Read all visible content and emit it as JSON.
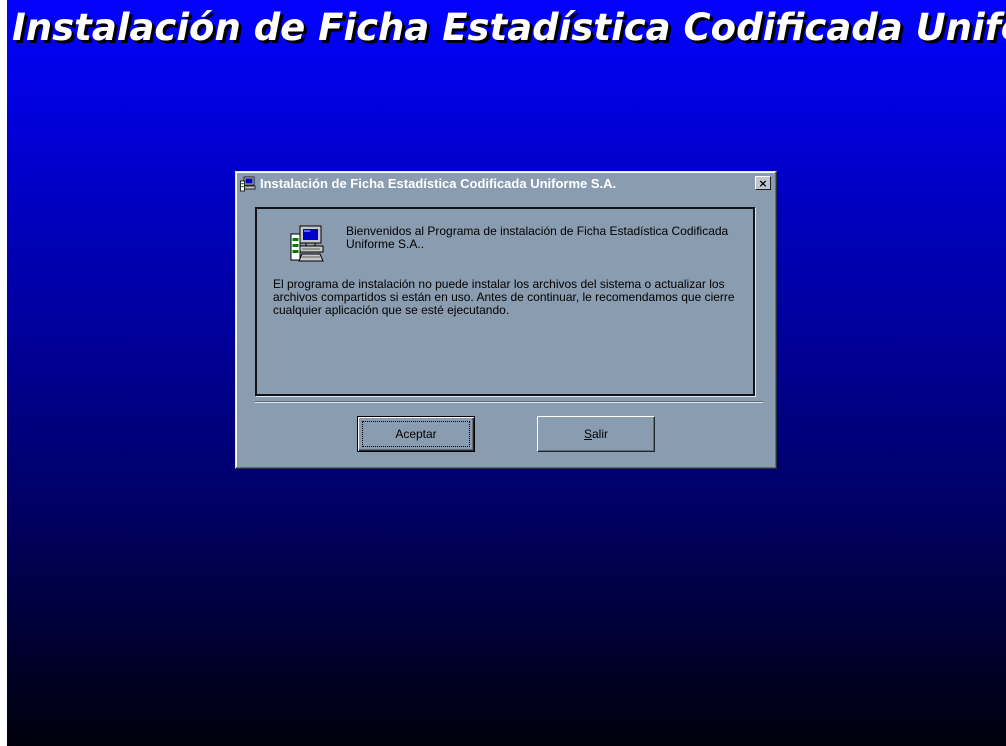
{
  "banner": {
    "title": "Instalación de Ficha Estadística Codificada Uniforme S.A."
  },
  "dialog": {
    "title": "Instalación de Ficha Estadística Codificada Uniforme S.A.",
    "title_icon": "setup-computer-icon",
    "close_label": "×",
    "welcome_icon": "setup-computer-icon",
    "welcome_text": "Bienvenidos al Programa de instalación de Ficha Estadística Codificada Uniforme S.A..",
    "body_text": "El programa de instalación no puede instalar los archivos del sistema o actualizar los archivos compartidos si están en uso. Antes de continuar, le recomendamos que cierre cualquier aplicación que se esté ejecutando.",
    "buttons": {
      "accept_label": "Aceptar",
      "exit_label": "Salir",
      "exit_mnemonic": "S",
      "exit_rest": "alir"
    }
  },
  "colors": {
    "desktop_top": "#0202ff",
    "desktop_bottom": "#00000c",
    "dialog_face": "#8a9cb0",
    "title_text": "#ffffff"
  }
}
